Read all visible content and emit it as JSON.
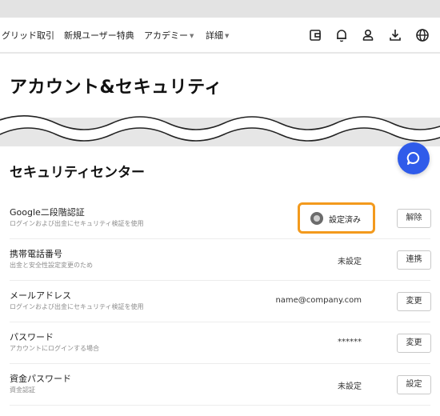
{
  "nav": {
    "links": [
      "グリッド取引",
      "新規ユーザー特典",
      "アカデミー",
      "詳細"
    ],
    "icons": [
      "wallet-icon",
      "bell-icon",
      "user-icon",
      "download-icon",
      "globe-icon"
    ]
  },
  "header": {
    "title": "アカウント&セキュリティ"
  },
  "security": {
    "title": "セキュリティセンター",
    "rows": [
      {
        "title": "Google二段階認証",
        "desc": "ログインおよび出金にセキュリティ検証を使用",
        "status": "設定済み",
        "action": "解除"
      },
      {
        "title": "携帯電話番号",
        "desc": "出金と安全性設定変更のため",
        "status": "未設定",
        "action": "連携"
      },
      {
        "title": "メールアドレス",
        "desc": "ログインおよび出金にセキュリティ検証を使用",
        "status": "name@company.com",
        "action": "変更"
      },
      {
        "title": "パスワード",
        "desc": "アカウントにログインする場合",
        "status": "******",
        "action": "変更"
      },
      {
        "title": "資金パスワード",
        "desc": "資金認証",
        "status": "未設定",
        "action": "設定"
      }
    ]
  },
  "colors": {
    "accent": "#2f5bea",
    "highlight": "#f39a1d"
  }
}
